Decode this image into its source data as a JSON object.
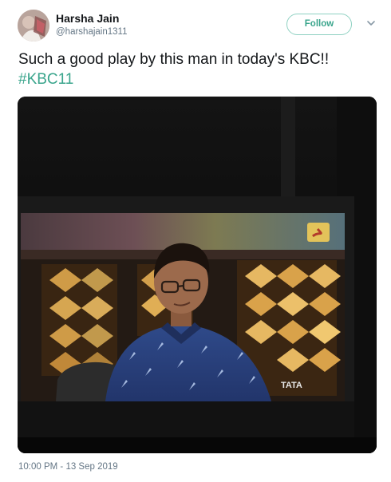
{
  "tweet": {
    "author_name": "Harsha Jain",
    "author_handle": "@harshajain1311",
    "follow_label": "Follow",
    "text": "Such a good play by this man in today's KBC!!",
    "hashtag": "#KBC11",
    "timestamp": "10:00 PM - 13 Sep 2019"
  },
  "media": {
    "tv_overlay_text": "TATA"
  },
  "colors": {
    "accent": "#3aa58c",
    "follow_border": "#8fd1c2",
    "secondary_text": "#657786"
  },
  "icons": {
    "caret": "chevron-down-icon"
  }
}
